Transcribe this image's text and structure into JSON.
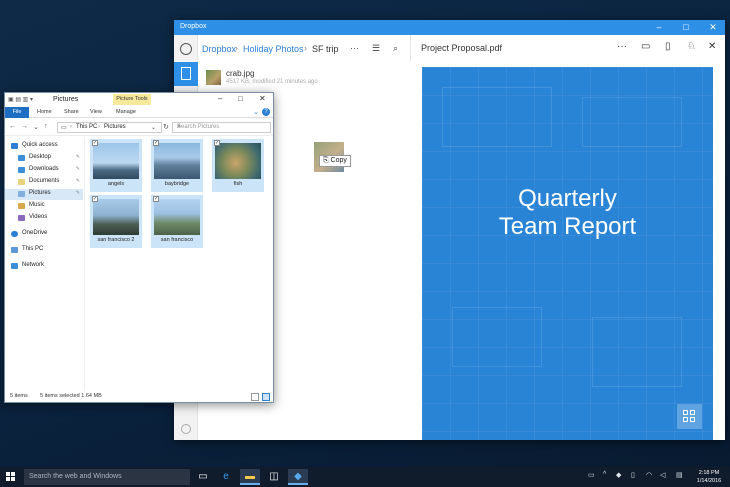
{
  "dropbox": {
    "window_title": "Dropbox",
    "breadcrumb": [
      "Dropbox",
      "Holiday Photos",
      "SF trip"
    ],
    "file": {
      "name": "crab.jpg",
      "meta": "4517 KB, modified 21 minutes ago"
    },
    "preview_title": "Project Proposal.pdf",
    "pdf_heading_line1": "Quarterly",
    "pdf_heading_line2": "Team Report"
  },
  "drag": {
    "tooltip": "Copy"
  },
  "explorer": {
    "title": "Pictures",
    "context_tab": "Picture Tools",
    "ribbon_tabs": [
      "File",
      "Home",
      "Share",
      "View",
      "Manage"
    ],
    "address": [
      "This PC",
      "Pictures"
    ],
    "search_placeholder": "Search Pictures",
    "tree": [
      {
        "label": "Quick access",
        "icon": "star-icon"
      },
      {
        "label": "Desktop",
        "icon": "folder-icon"
      },
      {
        "label": "Downloads",
        "icon": "download-icon"
      },
      {
        "label": "Documents",
        "icon": "folder-icon"
      },
      {
        "label": "Pictures",
        "icon": "folder-icon"
      },
      {
        "label": "Music",
        "icon": "music-icon"
      },
      {
        "label": "Videos",
        "icon": "video-icon"
      },
      {
        "label": "OneDrive",
        "icon": "cloud-icon"
      },
      {
        "label": "This PC",
        "icon": "computer-icon"
      },
      {
        "label": "Network",
        "icon": "network-icon"
      }
    ],
    "files": [
      {
        "name": "angels",
        "selected": true
      },
      {
        "name": "baybridge",
        "selected": true
      },
      {
        "name": "fish",
        "selected": true
      },
      {
        "name": "san francisco 2",
        "selected": true
      },
      {
        "name": "san francisco",
        "selected": true
      }
    ],
    "status_items": "5 items",
    "status_selected": "5 items selected  1.64 MB"
  },
  "taskbar": {
    "search_placeholder": "Search the web and Windows",
    "time": "2:18 PM",
    "date": "1/14/2016"
  }
}
